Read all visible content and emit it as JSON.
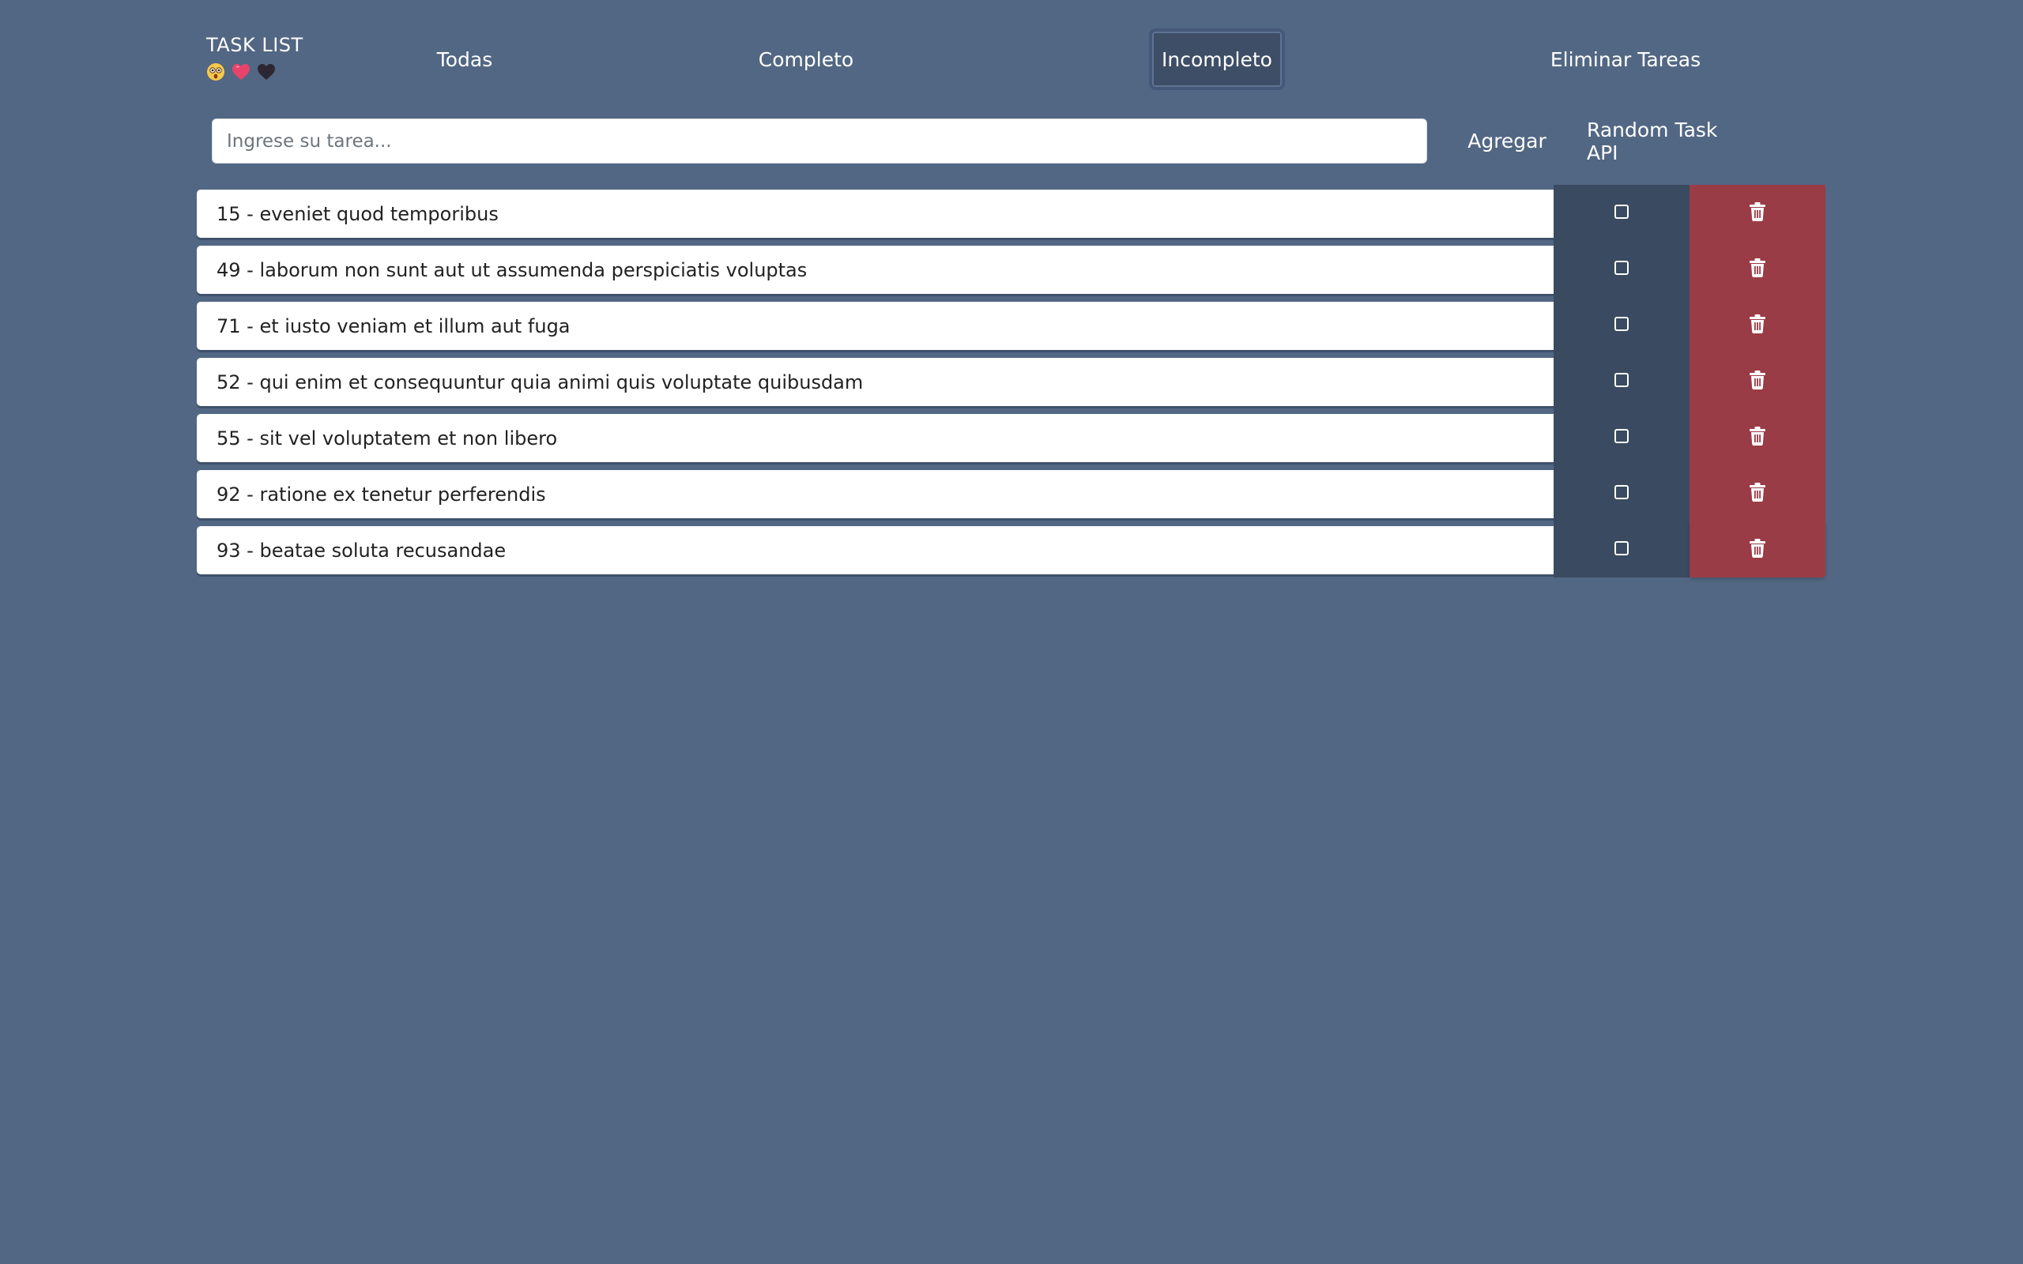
{
  "brand": {
    "title": "TASK LIST",
    "emojis": [
      "astonished-face-emoji",
      "pink-heart-emoji",
      "black-heart-emoji"
    ]
  },
  "nav": {
    "all": "Todas",
    "completed": "Completo",
    "incomplete": "Incompleto",
    "delete_tasks": "Eliminar Tareas",
    "active": "Incompleto"
  },
  "task_input": {
    "placeholder": "Ingrese su tarea...",
    "value": ""
  },
  "actions": {
    "add": "Agregar",
    "random": "Random Task API"
  },
  "tasks": [
    {
      "text": "15 - eveniet quod temporibus",
      "done": false
    },
    {
      "text": "49 - laborum non sunt aut ut assumenda perspiciatis voluptas",
      "done": false
    },
    {
      "text": "71 - et iusto veniam et illum aut fuga",
      "done": false
    },
    {
      "text": "52 - qui enim et consequuntur quia animi quis voluptate quibusdam",
      "done": false
    },
    {
      "text": "55 - sit vel voluptatem et non libero",
      "done": false
    },
    {
      "text": "92 - ratione ex tenetur perferendis",
      "done": false
    },
    {
      "text": "93 - beatae soluta recusandae",
      "done": false
    }
  ],
  "colors": {
    "background": "#526783",
    "check_column": "#3a4a60",
    "delete_column": "#9a3c45",
    "active_nav": "#3e4e66"
  }
}
